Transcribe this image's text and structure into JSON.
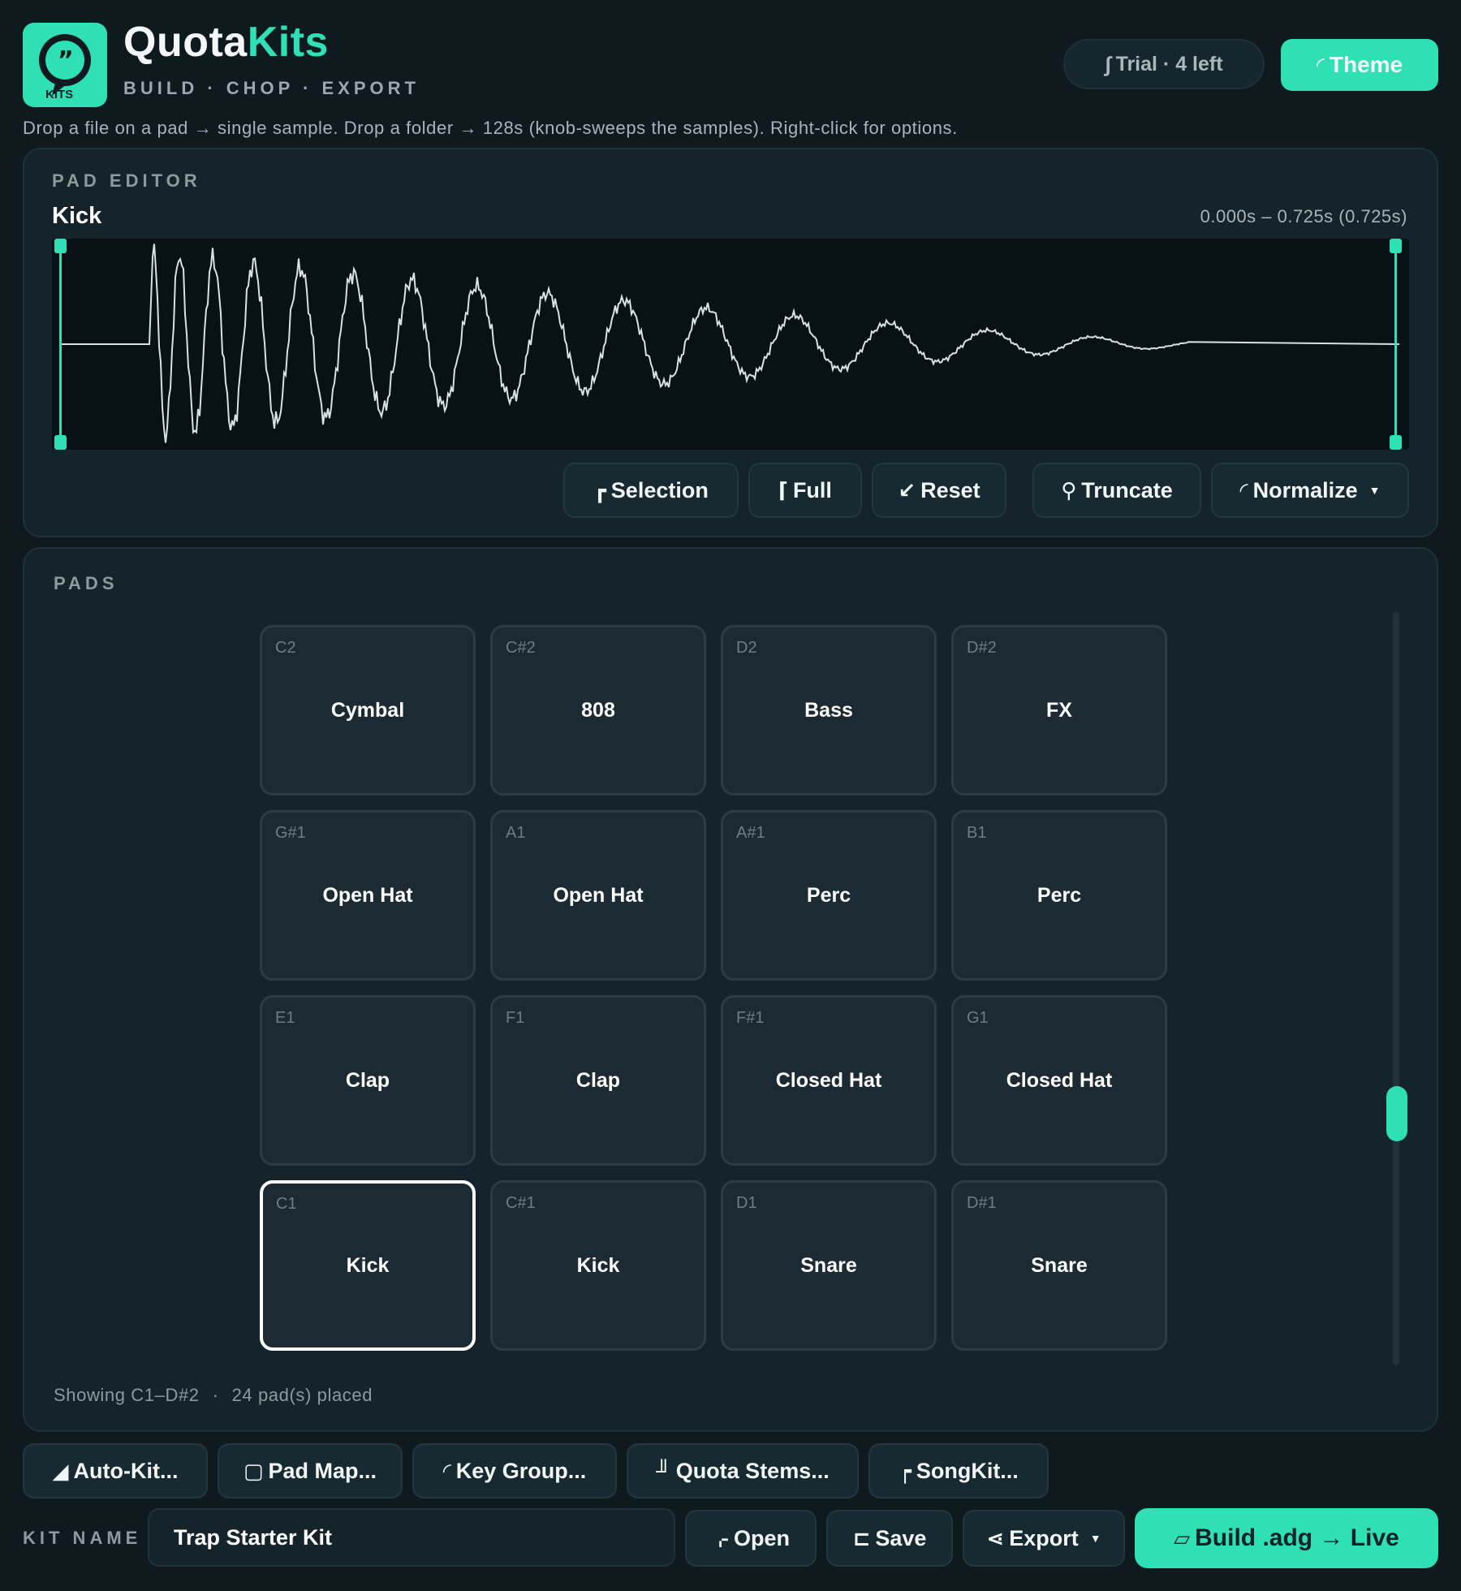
{
  "app": {
    "logo_text": "KITS",
    "brand_part1": "Quota",
    "brand_part2": "Kits",
    "tagline": "BUILD · CHOP · EXPORT",
    "hint": "Drop a file on a pad → single sample.   Drop a folder → 128s (knob-sweeps the samples).   Right-click for options."
  },
  "header": {
    "trial_label": "Trial · 4 left",
    "theme_label": "Theme"
  },
  "pad_editor": {
    "section_label": "PAD EDITOR",
    "sample_name": "Kick",
    "range": "0.000s – 0.725s   (0.725s)",
    "buttons": {
      "selection": "Selection",
      "full": "Full",
      "reset": "Reset",
      "truncate": "Truncate",
      "normalize": "Normalize"
    }
  },
  "pads": {
    "section_label": "PADS",
    "grid": [
      {
        "note": "C2",
        "name": "Cymbal",
        "selected": false
      },
      {
        "note": "C#2",
        "name": "808",
        "selected": false
      },
      {
        "note": "D2",
        "name": "Bass",
        "selected": false
      },
      {
        "note": "D#2",
        "name": "FX",
        "selected": false
      },
      {
        "note": "G#1",
        "name": "Open Hat",
        "selected": false
      },
      {
        "note": "A1",
        "name": "Open Hat",
        "selected": false
      },
      {
        "note": "A#1",
        "name": "Perc",
        "selected": false
      },
      {
        "note": "B1",
        "name": "Perc",
        "selected": false
      },
      {
        "note": "E1",
        "name": "Clap",
        "selected": false
      },
      {
        "note": "F1",
        "name": "Clap",
        "selected": false
      },
      {
        "note": "F#1",
        "name": "Closed Hat",
        "selected": false
      },
      {
        "note": "G1",
        "name": "Closed Hat",
        "selected": false
      },
      {
        "note": "C1",
        "name": "Kick",
        "selected": true
      },
      {
        "note": "C#1",
        "name": "Kick",
        "selected": false
      },
      {
        "note": "D1",
        "name": "Snare",
        "selected": false
      },
      {
        "note": "D#1",
        "name": "Snare",
        "selected": false
      }
    ],
    "status_showing": "Showing C1–D#2",
    "status_separator": "·",
    "status_count": "24 pad(s) placed"
  },
  "tools": {
    "auto_kit": "Auto-Kit...",
    "pad_map": "Pad Map...",
    "key_group": "Key Group...",
    "quota_stems": "Quota Stems...",
    "songkit": "SongKit..."
  },
  "kit": {
    "label": "KIT NAME",
    "name_value": "Trap Starter Kit",
    "open": "Open",
    "save": "Save",
    "export": "Export",
    "build": "Build .adg → Live"
  },
  "colors": {
    "accent": "#2ee0b4",
    "background": "#0f1a1f",
    "panel": "#15232a",
    "pad": "#1c2b33"
  },
  "icons": {
    "trial": "tilde-icon",
    "theme": "palette-icon",
    "selection": "corner-icon",
    "full": "bracket-icon",
    "reset": "undo-icon",
    "truncate": "search-icon",
    "normalize": "curve-icon"
  }
}
